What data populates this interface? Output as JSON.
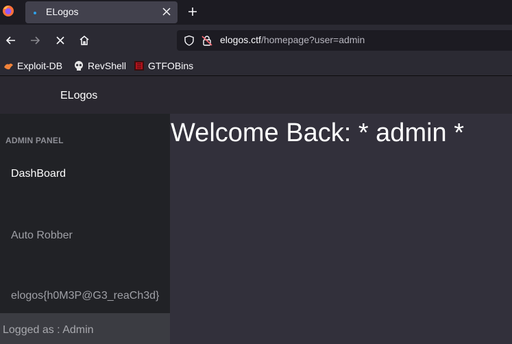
{
  "browser": {
    "tab": {
      "title": "ELogos"
    },
    "address_bar": {
      "host": "elogos.ctf",
      "path": "/homepage?user=admin"
    },
    "bookmarks": [
      {
        "label": "Exploit-DB",
        "icon": "exploitdb-icon"
      },
      {
        "label": "RevShell",
        "icon": "skull-icon"
      },
      {
        "label": "GTFOBins",
        "icon": "gtfobins-icon"
      }
    ]
  },
  "app": {
    "brand": "ELogos",
    "sidebar": {
      "heading": "ADMIN PANEL",
      "items": [
        {
          "label": "DashBoard"
        },
        {
          "label": "Auto Robber"
        },
        {
          "label": "elogos{h0M3P@G3_reaCh3d}"
        }
      ],
      "footer": "Logged as : Admin"
    },
    "main": {
      "welcome": "Welcome Back: * admin *"
    }
  },
  "colors": {
    "tab_strip": "#1c1b22",
    "toolbar": "#2b2a33",
    "sidebar": "#212226",
    "main": "#32303b",
    "footer": "#3b3c42"
  }
}
